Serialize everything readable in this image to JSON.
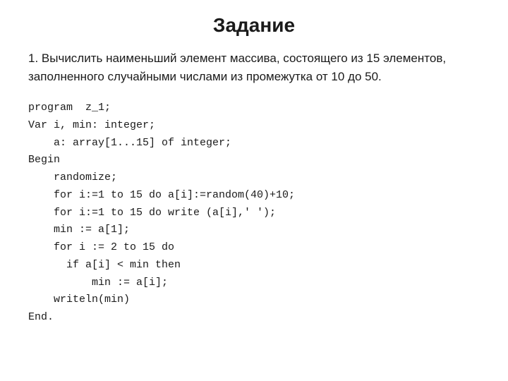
{
  "page": {
    "title": "Задание",
    "description": "1. Вычислить наименьший элемент массива, состоящего из 15 элементов, заполненного случайными числами из промежутка от 10 до 50.",
    "code": "program  z_1;\nVar i, min: integer;\n    a: array[1...15] of integer;\nBegin\n    randomize;\n    for i:=1 to 15 do a[i]:=random(40)+10;\n    for i:=1 to 15 do write (a[i],' ');\n    min := a[1];\n    for i := 2 to 15 do\n      if a[i] < min then\n          min := a[i];\n    writeln(min)\nEnd."
  }
}
